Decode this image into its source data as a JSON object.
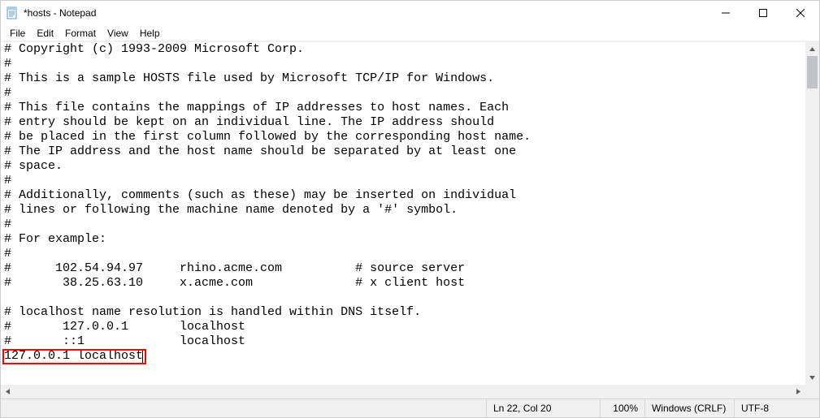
{
  "window": {
    "title": "*hosts - Notepad"
  },
  "menu": {
    "file": "File",
    "edit": "Edit",
    "format": "Format",
    "view": "View",
    "help": "Help"
  },
  "content": {
    "lines": [
      "# Copyright (c) 1993-2009 Microsoft Corp.",
      "#",
      "# This is a sample HOSTS file used by Microsoft TCP/IP for Windows.",
      "#",
      "# This file contains the mappings of IP addresses to host names. Each",
      "# entry should be kept on an individual line. The IP address should",
      "# be placed in the first column followed by the corresponding host name.",
      "# The IP address and the host name should be separated by at least one",
      "# space.",
      "#",
      "# Additionally, comments (such as these) may be inserted on individual",
      "# lines or following the machine name denoted by a '#' symbol.",
      "#",
      "# For example:",
      "#",
      "#      102.54.94.97     rhino.acme.com          # source server",
      "#       38.25.63.10     x.acme.com              # x client host",
      "",
      "# localhost name resolution is handled within DNS itself.",
      "#       127.0.0.1       localhost",
      "#       ::1             localhost",
      "127.0.0.1 localhost"
    ],
    "highlighted_line_index": 21
  },
  "status": {
    "position": "Ln 22, Col 20",
    "zoom": "100%",
    "line_ending": "Windows (CRLF)",
    "encoding": "UTF-8"
  }
}
